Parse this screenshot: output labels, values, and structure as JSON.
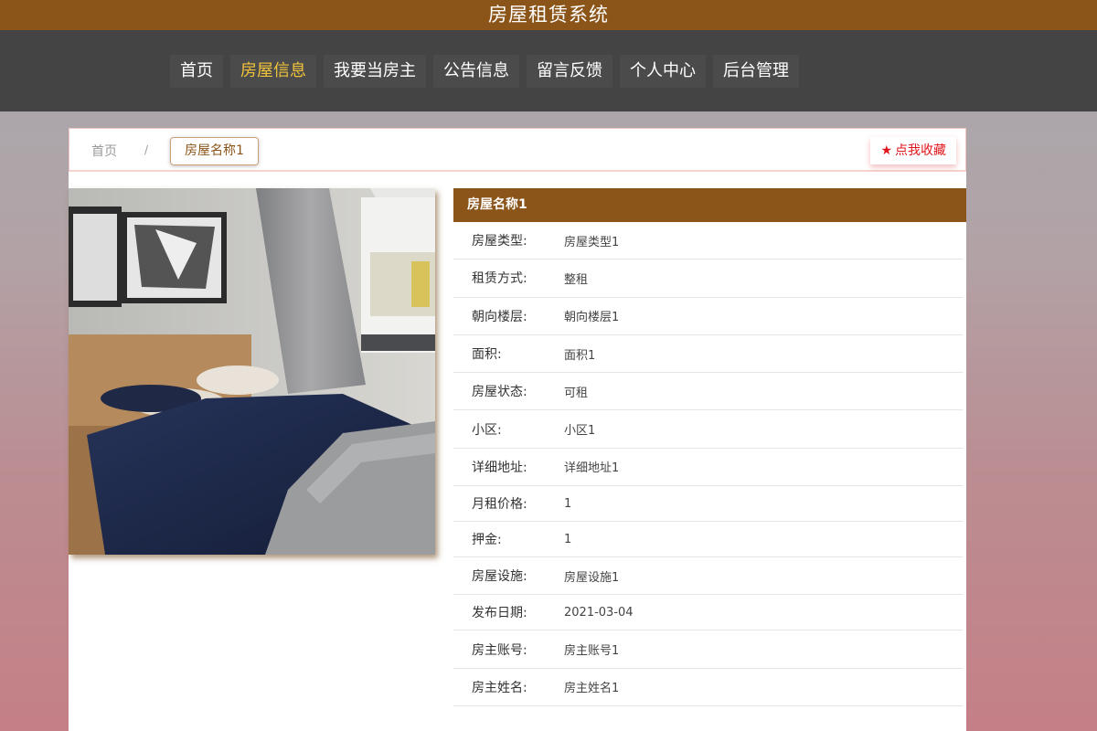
{
  "header": {
    "title": "房屋租赁系统"
  },
  "nav": {
    "items": [
      {
        "label": "首页"
      },
      {
        "label": "房屋信息",
        "active": true
      },
      {
        "label": "我要当房主"
      },
      {
        "label": "公告信息"
      },
      {
        "label": "留言反馈"
      },
      {
        "label": "个人中心"
      },
      {
        "label": "后台管理"
      }
    ]
  },
  "breadcrumb": {
    "home": "首页",
    "separator": "/",
    "current": "房屋名称1"
  },
  "favorite": {
    "icon": "star-icon",
    "label": "点我收藏"
  },
  "house": {
    "name": "房屋名称1",
    "fields": [
      {
        "label": "房屋类型:",
        "value": "房屋类型1"
      },
      {
        "label": "租赁方式:",
        "value": "整租"
      },
      {
        "label": "朝向楼层:",
        "value": "朝向楼层1"
      },
      {
        "label": "面积:",
        "value": "面积1"
      },
      {
        "label": "房屋状态:",
        "value": "可租"
      },
      {
        "label": "小区:",
        "value": "小区1"
      },
      {
        "label": "详细地址:",
        "value": "详细地址1"
      },
      {
        "label": "月租价格:",
        "value": "1"
      },
      {
        "label": "押金:",
        "value": "1"
      },
      {
        "label": "房屋设施:",
        "value": "房屋设施1"
      },
      {
        "label": "发布日期:",
        "value": "2021-03-04"
      },
      {
        "label": "房主账号:",
        "value": "房主账号1"
      },
      {
        "label": "房主姓名:",
        "value": "房主姓名1"
      }
    ]
  },
  "colors": {
    "brand": "#8b5418",
    "nav_bg": "#444444",
    "nav_active": "#f0c23a",
    "favorite": "#e0141b"
  }
}
